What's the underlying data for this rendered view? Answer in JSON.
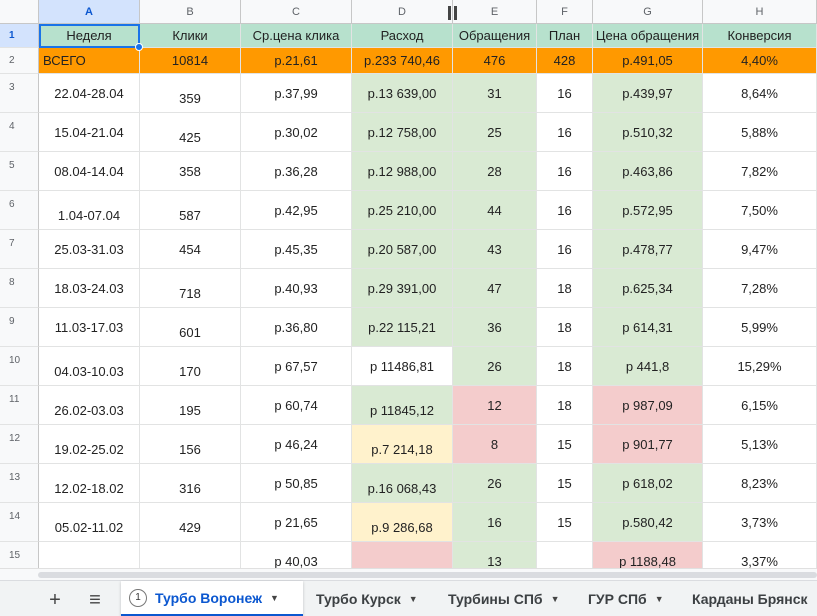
{
  "columns": [
    "A",
    "B",
    "C",
    "D",
    "E",
    "F",
    "G",
    "H"
  ],
  "row_numbers": [
    "1",
    "2",
    "3",
    "4",
    "5",
    "6",
    "7",
    "8",
    "9",
    "10",
    "11",
    "12",
    "13",
    "14",
    "15"
  ],
  "header": [
    "Неделя",
    "Клики",
    "Ср.цена клика",
    "Расход",
    "Обращения",
    "План",
    "Цена обращения",
    "Конверсия"
  ],
  "total": [
    "ВСЕГО",
    "10814",
    "р.21,61",
    "р.233 740,46",
    "476",
    "428",
    "р.491,05",
    "4,40%"
  ],
  "rows": [
    [
      "22.04-28.04",
      "359",
      "р.37,99",
      "р.13 639,00",
      "31",
      "16",
      "р.439,97",
      "8,64%"
    ],
    [
      "15.04-21.04",
      "425",
      "р.30,02",
      "р.12 758,00",
      "25",
      "16",
      "р.510,32",
      "5,88%"
    ],
    [
      "08.04-14.04",
      "358",
      "р.36,28",
      "р.12 988,00",
      "28",
      "16",
      "р.463,86",
      "7,82%"
    ],
    [
      "1.04-07.04",
      "587",
      "р.42,95",
      "р.25 210,00",
      "44",
      "16",
      "р.572,95",
      "7,50%"
    ],
    [
      "25.03-31.03",
      "454",
      "р.45,35",
      "р.20 587,00",
      "43",
      "16",
      "р.478,77",
      "9,47%"
    ],
    [
      "18.03-24.03",
      "718",
      "р.40,93",
      "р.29 391,00",
      "47",
      "18",
      "р.625,34",
      "7,28%"
    ],
    [
      "11.03-17.03",
      "601",
      "р.36,80",
      "р.22 115,21",
      "36",
      "18",
      "р 614,31",
      "5,99%"
    ],
    [
      "04.03-10.03",
      "170",
      "р 67,57",
      "р 11486,81",
      "26",
      "18",
      "р 441,8",
      "15,29%"
    ],
    [
      "26.02-03.03",
      "195",
      "р 60,74",
      "р 11845,12",
      "12",
      "18",
      "р 987,09",
      "6,15%"
    ],
    [
      "19.02-25.02",
      "156",
      "р 46,24",
      "р.7 214,18",
      "8",
      "15",
      "р 901,77",
      "5,13%"
    ],
    [
      "12.02-18.02",
      "316",
      "р 50,85",
      "р.16 068,43",
      "26",
      "15",
      "р 618,02",
      "8,23%"
    ],
    [
      "05.02-11.02",
      "429",
      "р 21,65",
      "р.9 286,68",
      "16",
      "15",
      "р.580,42",
      "3,73%"
    ],
    [
      "",
      "",
      "р 40,03",
      "",
      "13",
      "",
      "р 1188,48",
      "3,37%"
    ]
  ],
  "tabs": {
    "add_label": "+",
    "menu_label": "≡",
    "active_num": "1",
    "items": [
      "Турбо Воронеж",
      "Турбо Курск",
      "Турбины СПб",
      "ГУР СПб",
      "Карданы Брянск"
    ]
  },
  "colors": {
    "header_green": "#b7e1cd",
    "total_orange": "#ff9900",
    "cell_green": "#d9ead3",
    "cell_yellow": "#fff2cc",
    "cell_red": "#f4cccc",
    "accent_blue": "#0b57d0"
  }
}
